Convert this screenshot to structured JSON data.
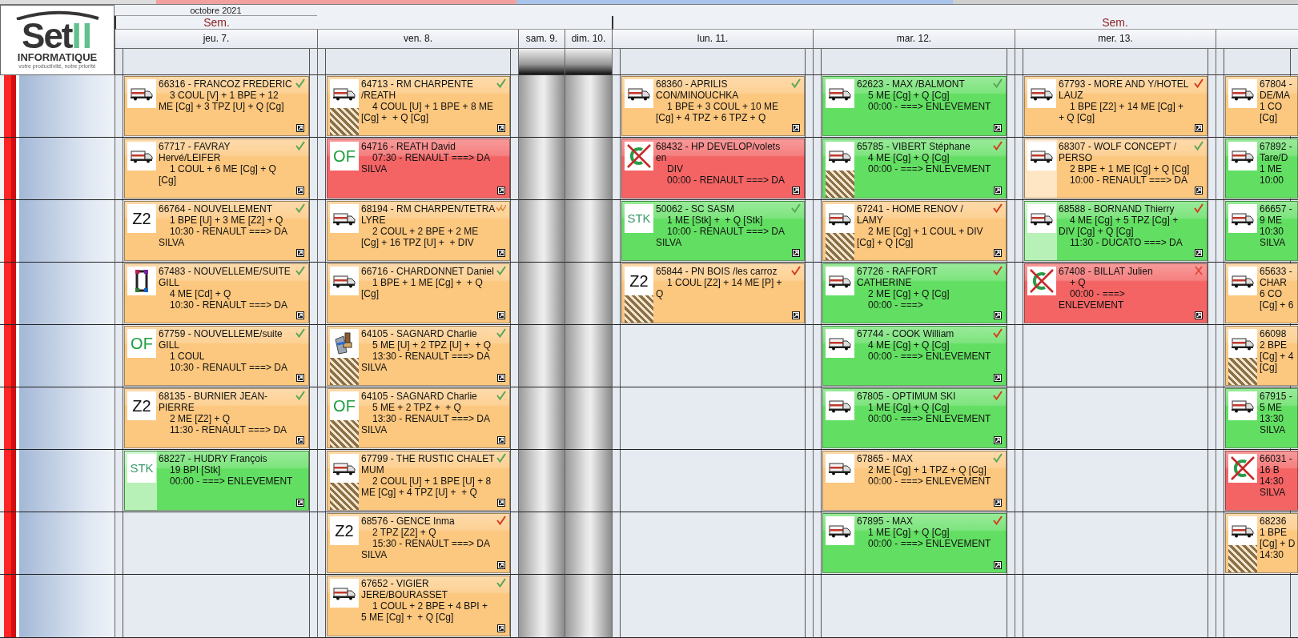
{
  "logo": {
    "word": "Set",
    "accent": "II",
    "subtitle": "INFORMATIQUE",
    "tagline": "votre productivité, notre priorité"
  },
  "calendar": {
    "month": "octobre 2021",
    "days": [
      {
        "label": "jeu. 7.",
        "week_label": "Sem.",
        "week_start": true,
        "weekend": false,
        "clipped": false,
        "cards": [
          {
            "color": "#fcc77e",
            "icon": {
              "kind": "van"
            },
            "hatched": false,
            "faded_side": false,
            "check": {
              "kind": "tick",
              "color": "#58a558"
            },
            "title": "66316 - FRANCOZ FREDERIC",
            "lines": [
              "3 COUL [V] + 1 BPE + 12 ME [Cg] + 3 TPZ [U] + Q [Cg]"
            ]
          },
          {
            "color": "#fcc77e",
            "icon": {
              "kind": "van"
            },
            "hatched": false,
            "faded_side": false,
            "check": {
              "kind": "tick",
              "color": "#58a558"
            },
            "title": "67717 - FAVRAY Hervé/LEIFER",
            "lines": [
              "1 COUL + 6 ME [Cg] + Q [Cg]"
            ]
          },
          {
            "color": "#fcc77e",
            "icon": {
              "kind": "code",
              "text": "Z2",
              "color": "#111111"
            },
            "hatched": false,
            "faded_side": false,
            "check": {
              "kind": "tick",
              "color": "#58a558"
            },
            "title": "66764 - NOUVELLEMENT",
            "lines": [
              "1 BPE [U] + 3 ME [Z2] + Q",
              "10:30 - RENAULT ===> DA SILVA"
            ]
          },
          {
            "color": "#fcc77e",
            "icon": {
              "kind": "frame"
            },
            "hatched": false,
            "faded_side": false,
            "check": {
              "kind": "tick",
              "color": "#58a558"
            },
            "title": "67483 - NOUVELLEME/SUITE GILL",
            "lines": [
              "4 ME [Cd] + Q",
              "10:30 - RENAULT ===> DA"
            ]
          },
          {
            "color": "#fcc77e",
            "icon": {
              "kind": "code",
              "text": "OF",
              "color": "#1e9e3e"
            },
            "hatched": false,
            "faded_side": false,
            "check": {
              "kind": "tick",
              "color": "#58a558"
            },
            "title": "67759 - NOUVELLEME/suite GILL",
            "lines": [
              "1 COUL",
              "10:30 - RENAULT ===> DA"
            ]
          },
          {
            "color": "#fcc77e",
            "icon": {
              "kind": "code",
              "text": "Z2",
              "color": "#111111"
            },
            "hatched": false,
            "faded_side": false,
            "check": {
              "kind": "tick",
              "color": "#58a558"
            },
            "title": "68135 - BURNIER JEAN-PIERRE",
            "lines": [
              "2 ME [Z2] + Q",
              "11:30 - RENAULT ===> DA"
            ]
          },
          {
            "color": "#62df62",
            "icon": {
              "kind": "code",
              "text": "STK",
              "color": "#3a9a6a"
            },
            "hatched": false,
            "faded_side": true,
            "title": "68227 - HUDRY François",
            "lines": [
              "19 BPI [Stk]",
              "00:00 - ===> ENLEVEMENT"
            ]
          }
        ]
      },
      {
        "label": "ven. 8.",
        "week_start": false,
        "weekend": false,
        "clipped": false,
        "cards": [
          {
            "color": "#fcc77e",
            "icon": {
              "kind": "van"
            },
            "hatched": true,
            "faded_side": false,
            "check": {
              "kind": "tick",
              "color": "#58a558"
            },
            "title": "64713 - RM CHARPENTE /REATH",
            "lines": [
              "4 COUL [U] + 1 BPE + 8 ME [Cg] +  + Q [Cg]"
            ]
          },
          {
            "color": "#f46464",
            "icon": {
              "kind": "code",
              "text": "OF",
              "color": "#1e9e3e"
            },
            "hatched": false,
            "faded_side": false,
            "title": "64716 - REATH David",
            "lines": [
              "07:30 - RENAULT ===> DA SILVA"
            ]
          },
          {
            "color": "#fcc77e",
            "icon": {
              "kind": "van"
            },
            "hatched": false,
            "faded_side": false,
            "check": {
              "kind": "double_tick",
              "color": "#d9893a"
            },
            "title": "68194 - RM CHARPEN/TETRA LYRE",
            "lines": [
              "2 COUL + 2 BPE + 2 ME [Cg] + 16 TPZ [U] +  + DIV"
            ]
          },
          {
            "color": "#fcc77e",
            "icon": {
              "kind": "van"
            },
            "hatched": false,
            "faded_side": false,
            "check": {
              "kind": "tick",
              "color": "#58a558"
            },
            "title": "66716 - CHARDONNET Daniel",
            "lines": [
              "1 BPE + 1 ME [Cg] +  + Q [Cg]"
            ]
          },
          {
            "color": "#fcc77e",
            "icon": {
              "kind": "brush"
            },
            "hatched": true,
            "faded_side": false,
            "check": {
              "kind": "tick",
              "color": "#58a558"
            },
            "title": "64105 - SAGNARD Charlie",
            "lines": [
              "5 ME [U] + 2 TPZ [U] +  + Q",
              "13:30 - RENAULT ===> DA SILVA"
            ]
          },
          {
            "color": "#fcc77e",
            "icon": {
              "kind": "code",
              "text": "OF",
              "color": "#1e9e3e"
            },
            "hatched": true,
            "faded_side": false,
            "check": {
              "kind": "tick",
              "color": "#58a558"
            },
            "title": "64105 - SAGNARD Charlie",
            "lines": [
              "5 ME + 2 TPZ +  + Q",
              "13:30 - RENAULT ===> DA SILVA"
            ]
          },
          {
            "color": "#fcc77e",
            "icon": {
              "kind": "van"
            },
            "hatched": true,
            "faded_side": false,
            "check": {
              "kind": "tick",
              "color": "#58a558"
            },
            "title": "67799 - THE RUSTIC CHALET MUM",
            "lines": [
              "2 COUL [U] + 1 BPE [U] + 8 ME [Cg] + 4 TPZ [U] +  + Q"
            ]
          },
          {
            "color": "#fcc77e",
            "icon": {
              "kind": "code",
              "text": "Z2",
              "color": "#111111"
            },
            "hatched": false,
            "faded_side": false,
            "check": {
              "kind": "tick",
              "color": "#d63a1e"
            },
            "title": "68576 - GENCE Inma",
            "lines": [
              "2 TPZ [Z2] + Q",
              "15:30 - RENAULT ===> DA SILVA"
            ]
          },
          {
            "color": "#fcc77e",
            "icon": {
              "kind": "van"
            },
            "hatched": false,
            "faded_side": false,
            "check": {
              "kind": "tick",
              "color": "#58a558"
            },
            "title": "67652 - VIGIER JERE/BOURASSET",
            "lines": [
              "1 COUL + 2 BPE + 4 BPI + 5 ME [Cg] +  + Q [Cg]"
            ]
          }
        ]
      },
      {
        "label": "sam. 9.",
        "week_start": false,
        "weekend": true,
        "clipped": false
      },
      {
        "label": "dim. 10.",
        "week_start": false,
        "weekend": true,
        "clipped": false
      },
      {
        "label": "lun. 11.",
        "week_start": true,
        "weekend": false,
        "clipped": false,
        "cards": [
          {
            "color": "#fcc77e",
            "icon": {
              "kind": "van"
            },
            "hatched": false,
            "faded_side": false,
            "check": {
              "kind": "tick",
              "color": "#58a558"
            },
            "title": "68360 - APRILIS CON/MINOUCHKA",
            "lines": [
              "1 BPE + 3 COUL + 10 ME [Cg] + 4 TPZ + 6 TPZ + Q"
            ]
          },
          {
            "color": "#f46464",
            "icon": {
              "kind": "crossed_out"
            },
            "hatched": false,
            "faded_side": false,
            "title": "68432 - HP DEVELOP/volets en",
            "lines": [
              "DIV",
              "00:00 - RENAULT ===> DA"
            ]
          },
          {
            "color": "#62df62",
            "icon": {
              "kind": "code",
              "text": "STK",
              "color": "#3a9a6a"
            },
            "hatched": false,
            "faded_side": false,
            "check": {
              "kind": "tick",
              "color": "#58a558"
            },
            "title": "50062 - SC SASM",
            "lines": [
              "1 ME [Stk] +  + Q [Stk]",
              "10:00 - RENAULT ===> DA SILVA"
            ]
          },
          {
            "color": "#fcc77e",
            "icon": {
              "kind": "code",
              "text": "Z2",
              "color": "#111111"
            },
            "hatched": true,
            "faded_side": false,
            "check": {
              "kind": "tick",
              "color": "#d63a1e"
            },
            "title": "65844 - PN BOIS /les carroz",
            "lines": [
              "1 COUL [Z2] + 14 ME [P] + Q"
            ]
          }
        ]
      },
      {
        "label": "mar. 12.",
        "week_start": false,
        "weekend": false,
        "clipped": false,
        "cards": [
          {
            "color": "#62df62",
            "icon": {
              "kind": "van"
            },
            "hatched": false,
            "faded_side": false,
            "check": {
              "kind": "tick",
              "color": "#58a558"
            },
            "title": "62623 - MAX /BALMONT",
            "lines": [
              "5 ME [Cg] + Q [Cg]",
              "00:00 - ===> ENLEVEMENT"
            ]
          },
          {
            "color": "#62df62",
            "icon": {
              "kind": "van"
            },
            "hatched": true,
            "faded_side": false,
            "check": {
              "kind": "tick",
              "color": "#d63a1e"
            },
            "title": "65785 - VIBERT Stéphane",
            "lines": [
              "4 ME [Cg] + Q [Cg]",
              "00:00 - ===> ENLEVEMENT"
            ]
          },
          {
            "color": "#fcc77e",
            "icon": {
              "kind": "van"
            },
            "hatched": true,
            "faded_side": false,
            "check": {
              "kind": "tick",
              "color": "#d63a1e"
            },
            "title": "67241 - HOME RENOV / LAMY",
            "lines": [
              "2 ME [Cg] + 1 COUL + DIV [Cg] + Q [Cg]"
            ]
          },
          {
            "color": "#62df62",
            "icon": {
              "kind": "van"
            },
            "hatched": false,
            "faded_side": false,
            "check": {
              "kind": "tick",
              "color": "#d63a1e"
            },
            "title": "67726 - RAFFORT CATHERINE",
            "lines": [
              "2 ME [Cg] + Q [Cg]",
              "00:00 - ===>"
            ]
          },
          {
            "color": "#62df62",
            "icon": {
              "kind": "van"
            },
            "hatched": false,
            "faded_side": false,
            "check": {
              "kind": "tick",
              "color": "#d63a1e"
            },
            "title": "67744 - COOK William",
            "lines": [
              "4 ME [Cg] + Q [Cg]",
              "00:00 - ===> ENLEVEMENT"
            ]
          },
          {
            "color": "#62df62",
            "icon": {
              "kind": "van"
            },
            "hatched": false,
            "faded_side": false,
            "check": {
              "kind": "tick",
              "color": "#d63a1e"
            },
            "title": "67805 - OPTIMUM SKI",
            "lines": [
              "1 ME [Cg] + Q [Cg]",
              "00:00 - ===> ENLEVEMENT"
            ]
          },
          {
            "color": "#fcc77e",
            "icon": {
              "kind": "van"
            },
            "hatched": false,
            "faded_side": false,
            "check": {
              "kind": "tick",
              "color": "#58a558"
            },
            "title": "67865 - MAX",
            "lines": [
              "2 ME [Cg] + 1 TPZ + Q [Cg]",
              "00:00 - ===> ENLEVEMENT"
            ]
          },
          {
            "color": "#62df62",
            "icon": {
              "kind": "van"
            },
            "hatched": false,
            "faded_side": false,
            "check": {
              "kind": "tick",
              "color": "#d63a1e"
            },
            "title": "67895 - MAX",
            "lines": [
              "1 ME [Cg] + Q [Cg]",
              "00:00 - ===> ENLEVEMENT"
            ]
          }
        ]
      },
      {
        "label": "mer. 13.",
        "week_label": "Sem.",
        "week_start": false,
        "weekend": false,
        "clipped": false,
        "cards": [
          {
            "color": "#fcc77e",
            "icon": {
              "kind": "van"
            },
            "hatched": false,
            "faded_side": false,
            "check": {
              "kind": "tick",
              "color": "#d63a1e"
            },
            "title": "67793 - MORE AND Y/HOTEL LAUZ",
            "lines": [
              "1 BPE [Z2] + 14 ME [Cg] +  + Q [Cg]"
            ]
          },
          {
            "color": "#fcc77e",
            "icon": {
              "kind": "van"
            },
            "hatched": false,
            "faded_side": true,
            "check": {
              "kind": "tick",
              "color": "#58a558"
            },
            "title": "68307 - WOLF CONCEPT / PERSO",
            "lines": [
              "2 BPE + 1 ME [Cg] + Q [Cg]",
              "10:00 - RENAULT ===> DA"
            ]
          },
          {
            "color": "#62df62",
            "icon": {
              "kind": "van"
            },
            "hatched": false,
            "faded_side": true,
            "check": {
              "kind": "tick",
              "color": "#d63a1e"
            },
            "title": "68588 - BORNAND Thierry",
            "lines": [
              "4 ME [Cg] + 5 TPZ [Cg] + DIV [Cg] + Q [Cg]",
              "11:30 - DUCATO ===> DA"
            ]
          },
          {
            "color": "#f46464",
            "icon": {
              "kind": "crossed_out"
            },
            "hatched": false,
            "faded_side": false,
            "check": {
              "kind": "cross",
              "color": "#e04b3a"
            },
            "title": "67408 - BILLAT Julien",
            "lines": [
              "+ Q",
              "00:00 - ===> ENLEVEMENT"
            ]
          }
        ]
      },
      {
        "week_start": false,
        "weekend": false,
        "clipped": true,
        "cards": [
          {
            "color": "#fcc77e",
            "icon": {
              "kind": "van"
            },
            "hatched": false,
            "faded_side": false,
            "title": "67804 -",
            "lines": [
              "DE/MA",
              "1 CO",
              "[Cg]"
            ]
          },
          {
            "color": "#62df62",
            "icon": {
              "kind": "van"
            },
            "hatched": false,
            "faded_side": false,
            "title": "67892 -",
            "lines": [
              "Tare/D",
              "1 ME",
              "10:00"
            ]
          },
          {
            "color": "#62df62",
            "icon": {
              "kind": "van"
            },
            "hatched": false,
            "faded_side": false,
            "title": "66657 -",
            "lines": [
              "9 ME",
              "10:30",
              "SILVA"
            ]
          },
          {
            "color": "#fcc77e",
            "icon": {
              "kind": "van"
            },
            "hatched": false,
            "faded_side": false,
            "title": "65633 -",
            "lines": [
              "CHAR",
              "6 CO",
              "[Cg] + 6"
            ]
          },
          {
            "color": "#fcc77e",
            "icon": {
              "kind": "van"
            },
            "hatched": true,
            "faded_side": false,
            "title": "66098",
            "lines": [
              "2 BPE",
              "[Cg] + 4",
              "[Cg]"
            ]
          },
          {
            "color": "#62df62",
            "icon": {
              "kind": "van"
            },
            "hatched": false,
            "faded_side": false,
            "title": "67915 -",
            "lines": [
              "5 ME",
              "13:30",
              "SILVA"
            ]
          },
          {
            "color": "#f46464",
            "icon": {
              "kind": "crossed_out"
            },
            "hatched": false,
            "faded_side": false,
            "title": "66031 -",
            "lines": [
              "16 B",
              "14:30",
              "SILVA"
            ]
          },
          {
            "color": "#fcc77e",
            "icon": {
              "kind": "van"
            },
            "hatched": true,
            "faded_side": false,
            "title": "68236",
            "lines": [
              "1 BPE",
              "[Cg] + D",
              "14:30"
            ]
          }
        ]
      }
    ]
  }
}
